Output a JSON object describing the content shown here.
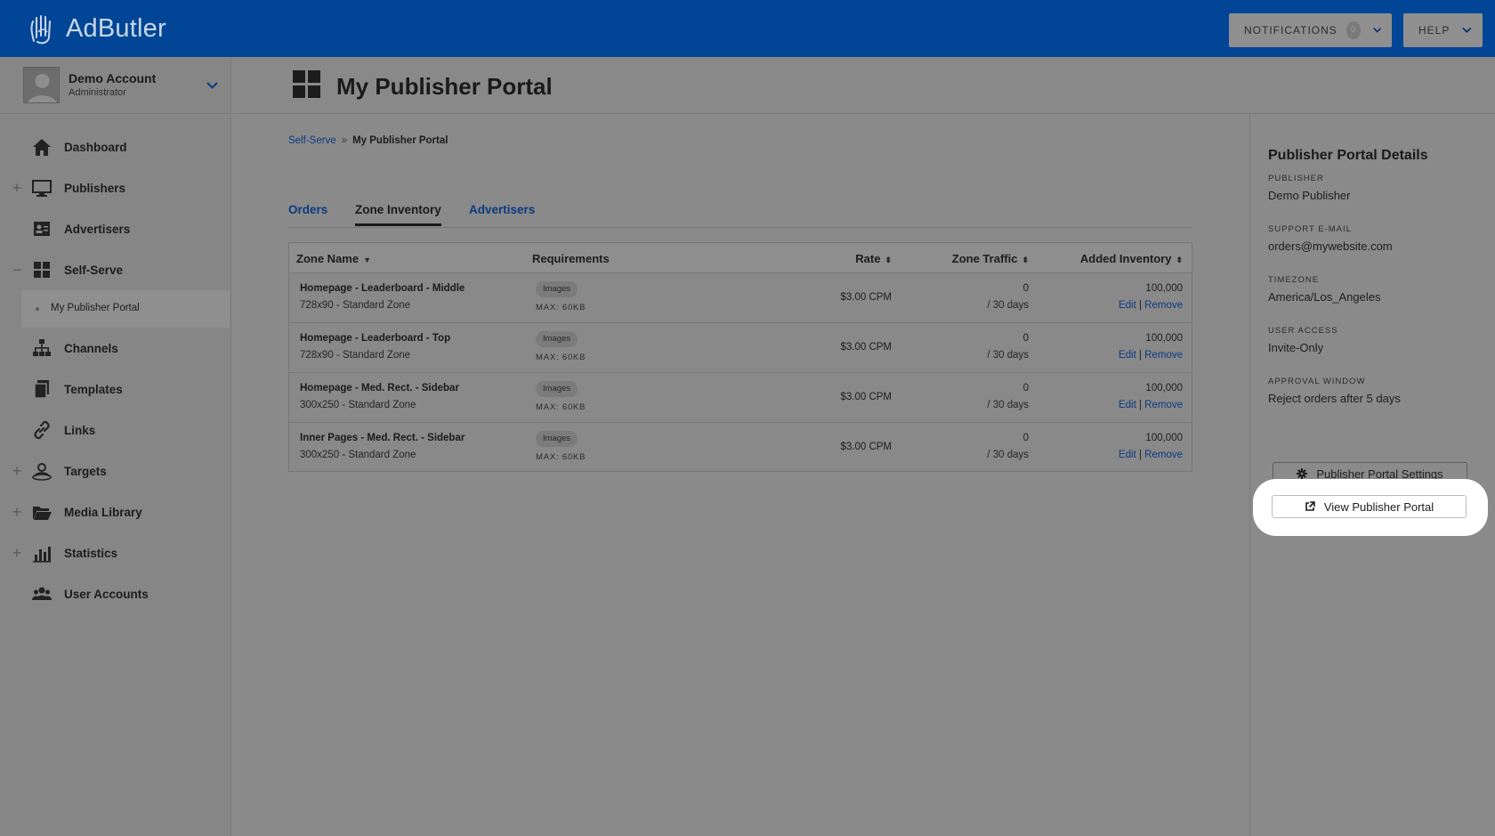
{
  "app": {
    "logo_text": "AdButler",
    "notifications_label": "NOTIFICATIONS",
    "notifications_count": "0",
    "help_label": "HELP"
  },
  "account": {
    "name": "Demo Account",
    "role": "Administrator"
  },
  "nav": {
    "items": [
      {
        "label": "Dashboard",
        "icon": "home-icon",
        "expander": ""
      },
      {
        "label": "Publishers",
        "icon": "monitor-icon",
        "expander": "+"
      },
      {
        "label": "Advertisers",
        "icon": "id-card-icon",
        "expander": ""
      },
      {
        "label": "Self-Serve",
        "icon": "grid-icon",
        "expander": "−"
      },
      {
        "label": "Channels",
        "icon": "sitemap-icon",
        "expander": ""
      },
      {
        "label": "Templates",
        "icon": "copy-icon",
        "expander": ""
      },
      {
        "label": "Links",
        "icon": "link-icon",
        "expander": ""
      },
      {
        "label": "Targets",
        "icon": "target-user-icon",
        "expander": "+"
      },
      {
        "label": "Media Library",
        "icon": "folder-icon",
        "expander": "+"
      },
      {
        "label": "Statistics",
        "icon": "bar-chart-icon",
        "expander": "+"
      },
      {
        "label": "User Accounts",
        "icon": "users-icon",
        "expander": ""
      }
    ],
    "sub_item": "My Publisher Portal"
  },
  "page": {
    "title": "My Publisher Portal",
    "breadcrumb": {
      "parent": "Self-Serve",
      "separator": "»",
      "current": "My Publisher Portal"
    }
  },
  "tabs": [
    {
      "label": "Orders"
    },
    {
      "label": "Zone Inventory"
    },
    {
      "label": "Advertisers"
    }
  ],
  "table": {
    "columns": {
      "zone_name": "Zone Name",
      "requirements": "Requirements",
      "rate": "Rate",
      "zone_traffic": "Zone Traffic",
      "added_inventory": "Added Inventory"
    },
    "rows": [
      {
        "name": "Homepage - Leaderboard - Middle",
        "size": "728x90 - Standard Zone",
        "req": "Images",
        "max": "MAX: 60KB",
        "rate": "$3.00 CPM",
        "traffic": "0",
        "period": "/ 30 days",
        "inventory": "100,000",
        "edit": "Edit",
        "sep": " | ",
        "remove": "Remove"
      },
      {
        "name": "Homepage - Leaderboard - Top",
        "size": "728x90 - Standard Zone",
        "req": "Images",
        "max": "MAX: 60KB",
        "rate": "$3.00 CPM",
        "traffic": "0",
        "period": "/ 30 days",
        "inventory": "100,000",
        "edit": "Edit",
        "sep": " | ",
        "remove": "Remove"
      },
      {
        "name": "Homepage - Med. Rect. - Sidebar",
        "size": "300x250 - Standard Zone",
        "req": "Images",
        "max": "MAX: 60KB",
        "rate": "$3.00 CPM",
        "traffic": "0",
        "period": "/ 30 days",
        "inventory": "100,000",
        "edit": "Edit",
        "sep": " | ",
        "remove": "Remove"
      },
      {
        "name": "Inner Pages - Med. Rect. - Sidebar",
        "size": "300x250 - Standard Zone",
        "req": "Images",
        "max": "MAX: 60KB",
        "rate": "$3.00 CPM",
        "traffic": "0",
        "period": "/ 30 days",
        "inventory": "100,000",
        "edit": "Edit",
        "sep": " | ",
        "remove": "Remove"
      }
    ]
  },
  "details": {
    "title": "Publisher Portal Details",
    "publisher_label": "PUBLISHER",
    "publisher": "Demo Publisher",
    "email_label": "SUPPORT E-MAIL",
    "email": "orders@mywebsite.com",
    "timezone_label": "TIMEZONE",
    "timezone": "America/Los_Angeles",
    "access_label": "USER ACCESS",
    "access": "Invite-Only",
    "approval_label": "APPROVAL WINDOW",
    "approval": "Reject orders after 5 days",
    "settings_button": "Publisher Portal Settings",
    "view_button": "View Publisher Portal"
  },
  "colors": {
    "brand_blue": "#014596",
    "link_blue": "#0c3a80",
    "overlay_gray": "#8a8a8a",
    "highlight": "#ffffff"
  }
}
